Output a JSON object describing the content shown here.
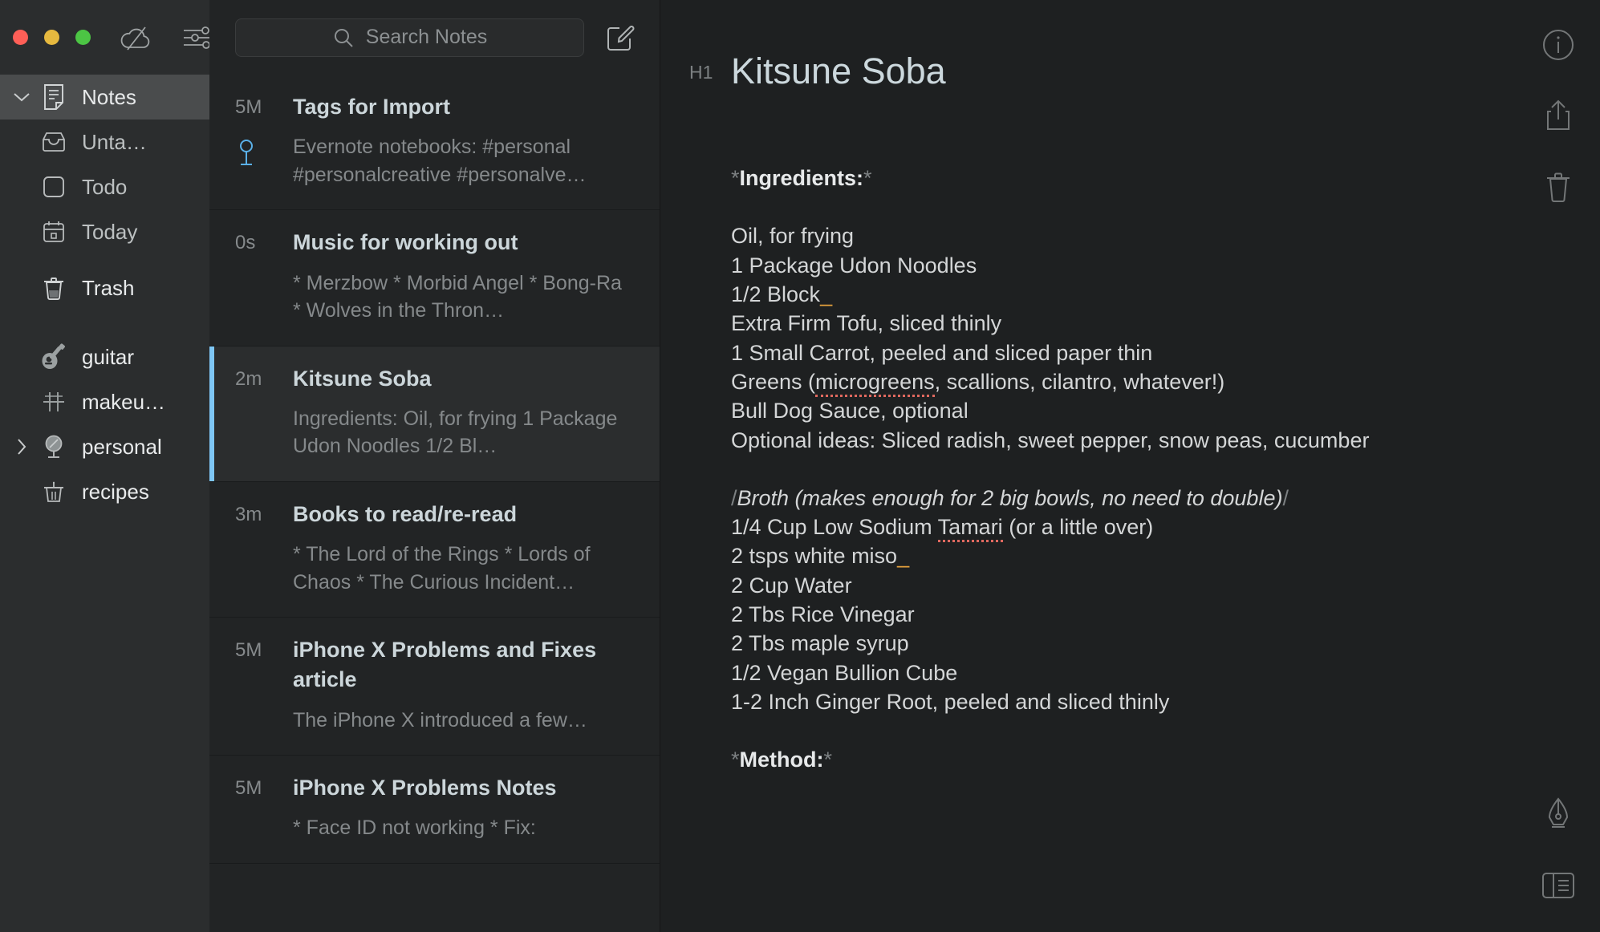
{
  "window": {
    "traffic_lights": [
      "close",
      "minimize",
      "maximize"
    ],
    "colors": {
      "close": "#ff5f57",
      "minimize": "#e6b93f",
      "maximize": "#4cc544",
      "accent": "#7ec6f5",
      "spellcheck": "#e0695f",
      "marker": "#e8a33d"
    },
    "toolbar_icons": [
      "cloud-off-icon",
      "sliders-icon"
    ]
  },
  "sidebar": {
    "items": [
      {
        "label": "Notes",
        "icon": "note-icon",
        "level": 0,
        "active": true,
        "chevron": "down"
      },
      {
        "label": "Unta…",
        "icon": "inbox-icon",
        "level": 1,
        "active": false,
        "chevron": ""
      },
      {
        "label": "Todo",
        "icon": "checkbox-icon",
        "level": 1,
        "active": false,
        "chevron": ""
      },
      {
        "label": "Today",
        "icon": "calendar-icon",
        "level": 1,
        "active": false,
        "chevron": ""
      },
      {
        "label": "Trash",
        "icon": "trash-icon",
        "level": 0,
        "active": false,
        "chevron": ""
      },
      {
        "label": "guitar",
        "icon": "guitar-icon",
        "level": 0,
        "active": false,
        "chevron": ""
      },
      {
        "label": "makeu…",
        "icon": "makeup-icon",
        "level": 0,
        "active": false,
        "chevron": ""
      },
      {
        "label": "personal",
        "icon": "mirror-icon",
        "level": 0,
        "active": false,
        "chevron": "right"
      },
      {
        "label": "recipes",
        "icon": "pot-icon",
        "level": 0,
        "active": false,
        "chevron": ""
      }
    ]
  },
  "notelist": {
    "search": {
      "placeholder": "Search Notes",
      "value": "",
      "icon": "search-icon"
    },
    "compose": {
      "icon": "compose-icon",
      "label": "New Note"
    },
    "notes": [
      {
        "time": "5M",
        "title": "Tags for Import",
        "preview": "Evernote notebooks: #personal #personalcreative #personalve…",
        "pinned": true,
        "selected": false
      },
      {
        "time": "0s",
        "title": "Music for working out",
        "preview": "* Merzbow * Morbid Angel * Bong-Ra * Wolves in the Thron…",
        "pinned": false,
        "selected": false
      },
      {
        "time": "2m",
        "title": "Kitsune Soba",
        "preview": "Ingredients: Oil, for frying 1 Package Udon Noodles 1/2 Bl…",
        "pinned": false,
        "selected": true
      },
      {
        "time": "3m",
        "title": "Books to read/re-read",
        "preview": "* The Lord of the Rings * Lords of Chaos * The Curious Incident…",
        "pinned": false,
        "selected": false
      },
      {
        "time": "5M",
        "title": "iPhone X Problems and Fixes article",
        "preview": "The iPhone X introduced a few…",
        "pinned": false,
        "selected": false
      },
      {
        "time": "5M",
        "title": "iPhone X Problems Notes",
        "preview": "* Face ID not working * Fix:",
        "pinned": false,
        "selected": false
      }
    ]
  },
  "editor": {
    "gutter_marker": "H1",
    "title": "Kitsune Soba",
    "lines": [
      {
        "type": "blank"
      },
      {
        "type": "bold",
        "pre": "*",
        "text": "Ingredients:",
        "post": "*"
      },
      {
        "type": "blank"
      },
      {
        "type": "plain",
        "text": "Oil, for frying"
      },
      {
        "type": "plain",
        "text": "1 Package Udon Noodles"
      },
      {
        "type": "marker-end",
        "text": "1/2 Block",
        "marker": "_"
      },
      {
        "type": "plain",
        "text": "Extra Firm Tofu, sliced thinly"
      },
      {
        "type": "plain",
        "text": "1 Small Carrot, peeled and sliced paper thin"
      },
      {
        "type": "spell",
        "before": "Greens (",
        "spell": "microgreens",
        "after": ", scallions, cilantro, whatever!)"
      },
      {
        "type": "plain",
        "text": "Bull Dog Sauce, optional"
      },
      {
        "type": "plain",
        "text": "Optional ideas: Sliced radish, sweet pepper, snow peas, cucumber"
      },
      {
        "type": "blank"
      },
      {
        "type": "ital",
        "pre": "/",
        "text": "Broth (makes enough for 2 big bowls, no need to double)",
        "post": "/"
      },
      {
        "type": "spell",
        "before": "1/4 Cup Low Sodium ",
        "spell": "Tamari",
        "after": " (or a little over)"
      },
      {
        "type": "marker-end",
        "text": "2 tsps white miso",
        "marker": "_"
      },
      {
        "type": "plain",
        "text": "2 Cup Water"
      },
      {
        "type": "plain",
        "text": "2 Tbs Rice Vinegar"
      },
      {
        "type": "plain",
        "text": "2 Tbs maple syrup"
      },
      {
        "type": "plain",
        "text": "1/2 Vegan Bullion Cube"
      },
      {
        "type": "plain",
        "text": "1-2 Inch Ginger Root, peeled and sliced thinly"
      },
      {
        "type": "blank"
      },
      {
        "type": "bold",
        "pre": "*",
        "text": "Method:",
        "post": "*"
      }
    ]
  },
  "rail": {
    "top": [
      {
        "icon": "info-icon",
        "label": "Info"
      },
      {
        "icon": "share-icon",
        "label": "Share"
      },
      {
        "icon": "trash-icon",
        "label": "Delete"
      }
    ],
    "bottom": [
      {
        "icon": "pen-nib-icon",
        "label": "Theme"
      },
      {
        "icon": "split-view-icon",
        "label": "Layout"
      }
    ]
  }
}
